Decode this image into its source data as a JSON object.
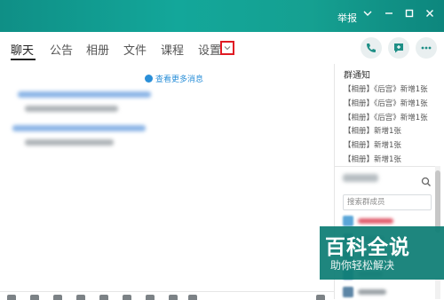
{
  "titlebar": {
    "title": "",
    "report_label": "举报",
    "controls": [
      "chevron-down-icon",
      "minimize-icon",
      "maximize-icon",
      "close-icon"
    ]
  },
  "tabs": {
    "items": [
      "聊天",
      "公告",
      "相册",
      "文件",
      "课程",
      "设置"
    ],
    "active": "聊天"
  },
  "chat": {
    "load_more": "查看更多消息"
  },
  "notices": {
    "title": "群通知",
    "items": [
      "【相册】《后宫》新增1张",
      "【相册】《后宫》新增1张",
      "【相册】《后宫》新增1张",
      "【相册】新增1张",
      "【相册】新增1张",
      "【相册】新增1张"
    ]
  },
  "members": {
    "search_placeholder": "搜索群成员"
  },
  "watermark": {
    "brand": "百科全说",
    "slogan": "助你轻松解决"
  },
  "colors": {
    "titlebar": "#13a79a",
    "link": "#2a8fd8",
    "highlight": "#e01b24",
    "watermark": "#107e76"
  }
}
